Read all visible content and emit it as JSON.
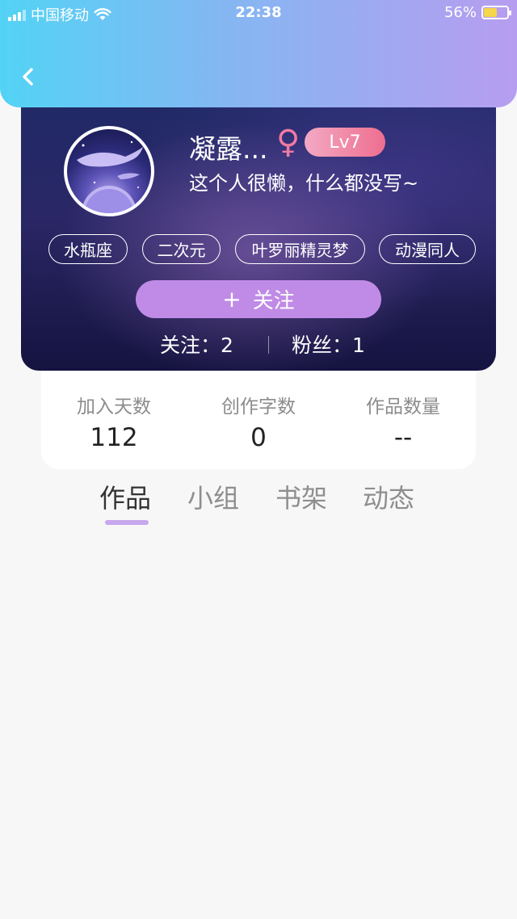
{
  "status_bar": {
    "carrier": "中国移动",
    "time": "22:38",
    "battery_percent": "56%",
    "battery_level": 0.56,
    "signal_icon": "cellular-signal-icon",
    "wifi_icon": "wifi-icon",
    "battery_icon": "battery-charging-icon"
  },
  "header": {
    "back_icon": "chevron-left-icon",
    "gradient_colors": [
      "#53d3f5",
      "#86b6f2",
      "#b79df0"
    ]
  },
  "profile": {
    "nickname": "凝露...",
    "gender_symbol": "♀",
    "level": "Lv7",
    "signature": "这个人很懒，什么都没写~",
    "tags": [
      "水瓶座",
      "二次元",
      "叶罗丽精灵梦",
      "动漫同人"
    ],
    "follow_plus": "+",
    "follow_label": "关注",
    "following_label": "关注：",
    "following_count": "2",
    "followers_label": "粉丝：",
    "followers_count": "1",
    "accent_color": "#c08be6",
    "gender_color": "#f07aa3"
  },
  "stats": [
    {
      "label": "加入天数",
      "value": "112"
    },
    {
      "label": "创作字数",
      "value": "0"
    },
    {
      "label": "作品数量",
      "value": "--"
    }
  ],
  "tabs": [
    {
      "label": "作品",
      "active": true
    },
    {
      "label": "小组",
      "active": false
    },
    {
      "label": "书架",
      "active": false
    },
    {
      "label": "动态",
      "active": false
    }
  ]
}
